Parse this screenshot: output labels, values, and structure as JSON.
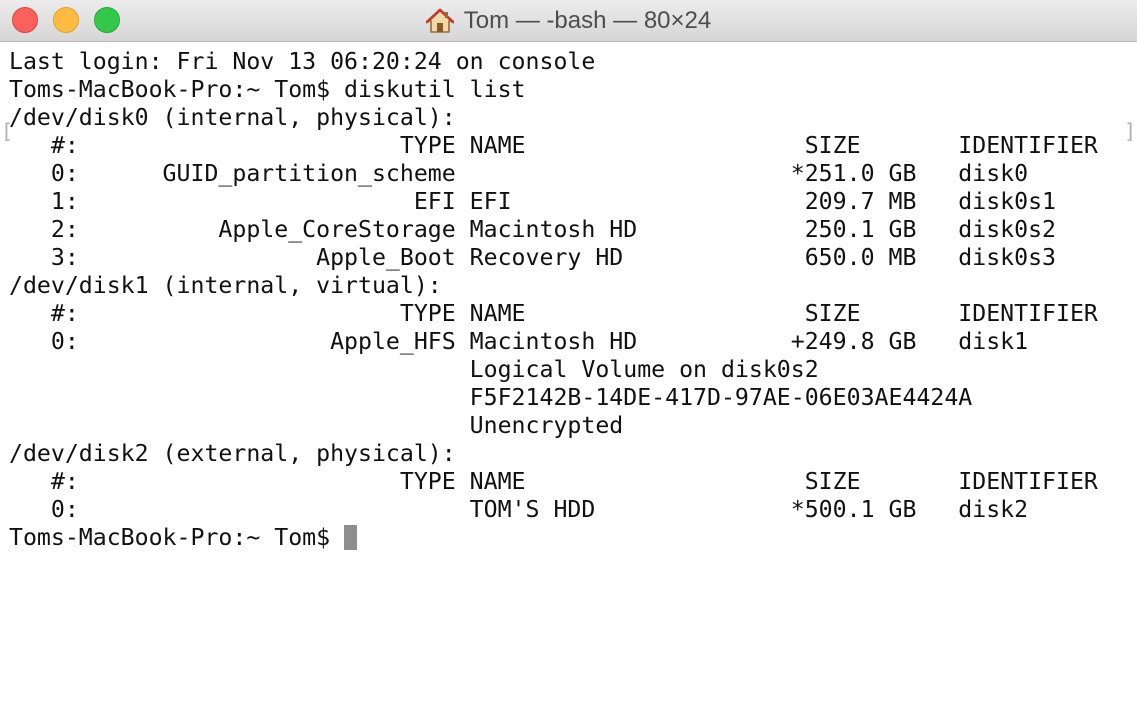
{
  "window": {
    "title": "Tom — -bash — 80×24"
  },
  "terminal": {
    "lines": [
      "Last login: Fri Nov 13 06:20:24 on console",
      "Toms-MacBook-Pro:~ Tom$ diskutil list",
      "/dev/disk0 (internal, physical):",
      "   #:                       TYPE NAME                    SIZE       IDENTIFIER",
      "   0:      GUID_partition_scheme                        *251.0 GB   disk0",
      "   1:                        EFI EFI                     209.7 MB   disk0s1",
      "   2:          Apple_CoreStorage Macintosh HD            250.1 GB   disk0s2",
      "   3:                 Apple_Boot Recovery HD             650.0 MB   disk0s3",
      "/dev/disk1 (internal, virtual):",
      "   #:                       TYPE NAME                    SIZE       IDENTIFIER",
      "   0:                  Apple_HFS Macintosh HD           +249.8 GB   disk1",
      "                                 Logical Volume on disk0s2",
      "                                 F5F2142B-14DE-417D-97AE-06E03AE4424A",
      "                                 Unencrypted",
      "/dev/disk2 (external, physical):",
      "   #:                       TYPE NAME                    SIZE       IDENTIFIER",
      "   0:                            TOM'S HDD              *500.1 GB   disk2"
    ],
    "prompt": "Toms-MacBook-Pro:~ Tom$ ",
    "bracket_left": "[",
    "bracket_right": "]"
  }
}
